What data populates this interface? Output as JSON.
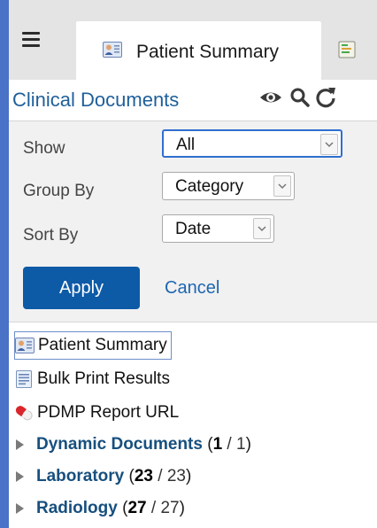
{
  "tabs": {
    "active_label": "Patient Summary"
  },
  "header": {
    "title": "Clinical Documents"
  },
  "filters": {
    "show_label": "Show",
    "show_value": "All",
    "group_label": "Group By",
    "group_value": "Category",
    "sort_label": "Sort By",
    "sort_value": "Date",
    "apply_label": "Apply",
    "cancel_label": "Cancel"
  },
  "tree": {
    "items": [
      {
        "label": "Patient Summary",
        "icon": "patient-summary-icon"
      },
      {
        "label": "Bulk Print Results",
        "icon": "document-icon"
      },
      {
        "label": "PDMP Report URL",
        "icon": "pill-icon"
      }
    ],
    "categories": [
      {
        "name": "Dynamic Documents",
        "count": "1",
        "total": "1"
      },
      {
        "name": "Laboratory",
        "count": "23",
        "total": "23"
      },
      {
        "name": "Radiology",
        "count": "27",
        "total": "27"
      }
    ]
  },
  "colors": {
    "window_border": "#4a72c6",
    "title": "#1f5f9a",
    "apply_bg": "#0d5aa7",
    "link": "#1e66b1",
    "category": "#174f7e"
  }
}
